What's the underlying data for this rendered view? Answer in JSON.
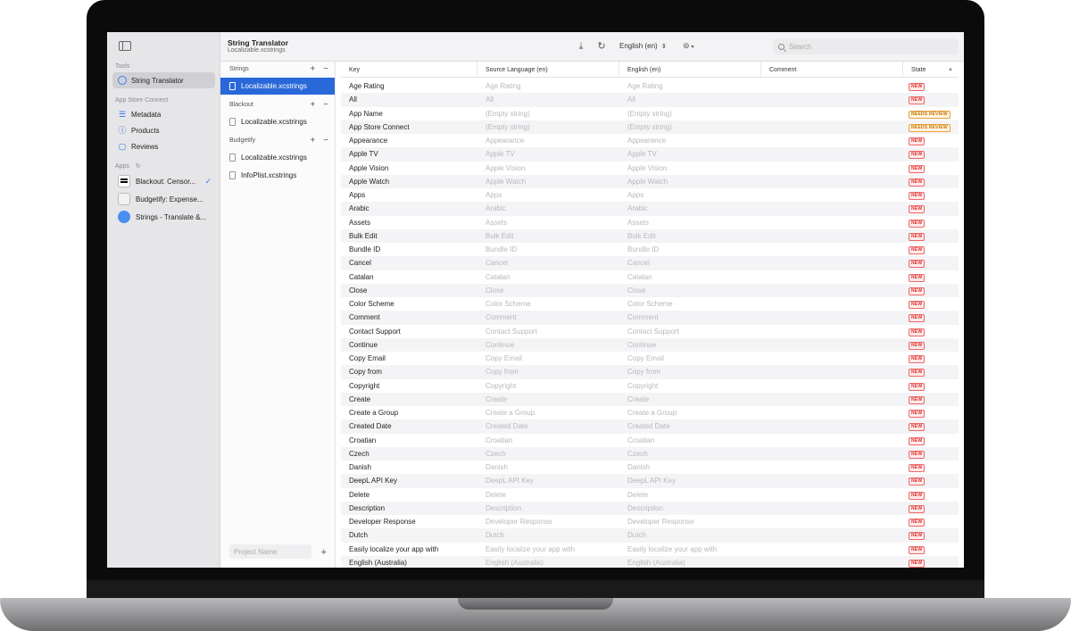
{
  "sidebar": {
    "tools_label": "Tools",
    "tools": [
      {
        "label": "String Translator",
        "icon": "globe-icon",
        "selected": true
      }
    ],
    "asc_label": "App Store Connect",
    "asc_items": [
      {
        "label": "Metadata",
        "icon": "list-icon"
      },
      {
        "label": "Products",
        "icon": "info-icon"
      },
      {
        "label": "Reviews",
        "icon": "message-icon"
      }
    ],
    "apps_label": "Apps",
    "apps": [
      {
        "label": "Blackout: Censor...",
        "checked": true
      },
      {
        "label": "Budgetify: Expense..."
      },
      {
        "label": "Strings - Translate &..."
      }
    ]
  },
  "header": {
    "title": "String Translator",
    "subtitle": "Localizable.xcstrings",
    "language": "English (en)",
    "search_placeholder": "Search"
  },
  "files": {
    "groups": [
      {
        "name": "Strings",
        "files": [
          {
            "name": "Localizable.xcstrings",
            "selected": true
          }
        ]
      },
      {
        "name": "Blackout",
        "files": [
          {
            "name": "Localizable.xcstrings"
          }
        ]
      },
      {
        "name": "Budgetify",
        "files": [
          {
            "name": "Localizable.xcstrings"
          },
          {
            "name": "InfoPlist.xcstrings"
          }
        ]
      }
    ],
    "project_placeholder": "Project Name"
  },
  "table": {
    "columns": {
      "key": "Key",
      "source": "Source Language (en)",
      "english": "English (en)",
      "comment": "Comment",
      "state": "State"
    },
    "rows": [
      {
        "key": "Age Rating",
        "source": "Age Rating",
        "english": "Age Rating",
        "state": "NEW"
      },
      {
        "key": "All",
        "source": "All",
        "english": "All",
        "state": "NEW"
      },
      {
        "key": "App Name",
        "source": "(Empty string)",
        "english": "(Empty string)",
        "state": "NEEDS REVIEW"
      },
      {
        "key": "App Store Connect",
        "source": "(Empty string)",
        "english": "(Empty string)",
        "state": "NEEDS REVIEW"
      },
      {
        "key": "Appearance",
        "source": "Appearance",
        "english": "Appearance",
        "state": "NEW"
      },
      {
        "key": "Apple TV",
        "source": "Apple TV",
        "english": "Apple TV",
        "state": "NEW"
      },
      {
        "key": "Apple Vision",
        "source": "Apple Vision",
        "english": "Apple Vision",
        "state": "NEW"
      },
      {
        "key": "Apple Watch",
        "source": "Apple Watch",
        "english": "Apple Watch",
        "state": "NEW"
      },
      {
        "key": "Apps",
        "source": "Apps",
        "english": "Apps",
        "state": "NEW"
      },
      {
        "key": "Arabic",
        "source": "Arabic",
        "english": "Arabic",
        "state": "NEW"
      },
      {
        "key": "Assets",
        "source": "Assets",
        "english": "Assets",
        "state": "NEW"
      },
      {
        "key": "Bulk Edit",
        "source": "Bulk Edit",
        "english": "Bulk Edit",
        "state": "NEW"
      },
      {
        "key": "Bundle ID",
        "source": "Bundle ID",
        "english": "Bundle ID",
        "state": "NEW"
      },
      {
        "key": "Cancel",
        "source": "Cancel",
        "english": "Cancel",
        "state": "NEW"
      },
      {
        "key": "Catalan",
        "source": "Catalan",
        "english": "Catalan",
        "state": "NEW"
      },
      {
        "key": "Close",
        "source": "Close",
        "english": "Close",
        "state": "NEW"
      },
      {
        "key": "Color Scheme",
        "source": "Color Scheme",
        "english": "Color Scheme",
        "state": "NEW"
      },
      {
        "key": "Comment",
        "source": "Comment",
        "english": "Comment",
        "state": "NEW"
      },
      {
        "key": "Contact Support",
        "source": "Contact Support",
        "english": "Contact Support",
        "state": "NEW"
      },
      {
        "key": "Continue",
        "source": "Continue",
        "english": "Continue",
        "state": "NEW"
      },
      {
        "key": "Copy Email",
        "source": "Copy Email",
        "english": "Copy Email",
        "state": "NEW"
      },
      {
        "key": "Copy from",
        "source": "Copy from",
        "english": "Copy from",
        "state": "NEW"
      },
      {
        "key": "Copyright",
        "source": "Copyright",
        "english": "Copyright",
        "state": "NEW"
      },
      {
        "key": "Create",
        "source": "Create",
        "english": "Create",
        "state": "NEW"
      },
      {
        "key": "Create a Group",
        "source": "Create a Group",
        "english": "Create a Group",
        "state": "NEW"
      },
      {
        "key": "Created Date",
        "source": "Created Date",
        "english": "Created Date",
        "state": "NEW"
      },
      {
        "key": "Croatian",
        "source": "Croatian",
        "english": "Croatian",
        "state": "NEW"
      },
      {
        "key": "Czech",
        "source": "Czech",
        "english": "Czech",
        "state": "NEW"
      },
      {
        "key": "Danish",
        "source": "Danish",
        "english": "Danish",
        "state": "NEW"
      },
      {
        "key": "DeepL API Key",
        "source": "DeepL API Key",
        "english": "DeepL API Key",
        "state": "NEW"
      },
      {
        "key": "Delete",
        "source": "Delete",
        "english": "Delete",
        "state": "NEW"
      },
      {
        "key": "Description",
        "source": "Description",
        "english": "Description",
        "state": "NEW"
      },
      {
        "key": "Developer Response",
        "source": "Developer Response",
        "english": "Developer Response",
        "state": "NEW"
      },
      {
        "key": "Dutch",
        "source": "Dutch",
        "english": "Dutch",
        "state": "NEW"
      },
      {
        "key": "Easily localize your app with",
        "source": "Easily localize your app with",
        "english": "Easily localize your app with",
        "state": "NEW"
      },
      {
        "key": "English (Australia)",
        "source": "English (Australia)",
        "english": "English (Australia)",
        "state": "NEW"
      }
    ]
  }
}
